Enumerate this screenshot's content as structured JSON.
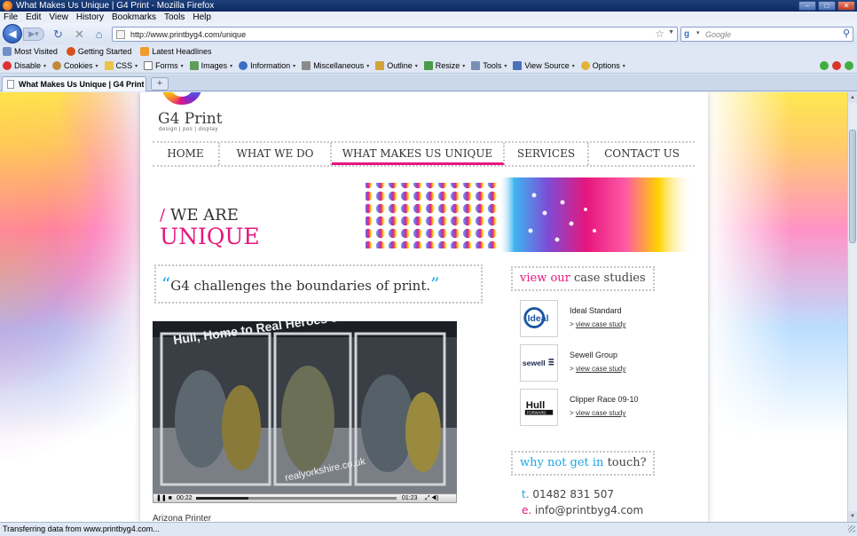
{
  "window": {
    "title": "What Makes Us Unique | G4 Print - Mozilla Firefox",
    "controls": [
      "–",
      "□",
      "✕"
    ]
  },
  "menu": [
    "File",
    "Edit",
    "View",
    "History",
    "Bookmarks",
    "Tools",
    "Help"
  ],
  "navigation": {
    "url": "http://www.printbyg4.com/unique",
    "search_placeholder": "Google"
  },
  "bookmarks": [
    "Most Visited",
    "Getting Started",
    "Latest Headlines"
  ],
  "devtoolbar": [
    "Disable",
    "Cookies",
    "CSS",
    "Forms",
    "Images",
    "Information",
    "Miscellaneous",
    "Outline",
    "Resize",
    "Tools",
    "View Source",
    "Options"
  ],
  "tab": {
    "label": "What Makes Us Unique | G4 Print",
    "new_tab": "+"
  },
  "site": {
    "logo": {
      "name": "G4 Print",
      "tagline": "design | pos | display"
    },
    "nav": [
      {
        "label": "HOME",
        "active": false
      },
      {
        "label": "WHAT WE DO",
        "active": false
      },
      {
        "label": "WHAT MAKES US UNIQUE",
        "active": true
      },
      {
        "label": "SERVICES",
        "active": false
      },
      {
        "label": "CONTACT US",
        "active": false
      }
    ],
    "banner": {
      "slash": "/",
      "line1": "WE ARE",
      "line2": "UNIQUE"
    },
    "quote": {
      "open": "“",
      "text": "G4 challenges the boundaries of print.",
      "close": "”"
    },
    "video": {
      "sign_text": "Hull, Home to Real Heroes & Champions",
      "url_text": "realyorkshire.co.uk",
      "time_current": "00:22",
      "time_total": "01:23",
      "progress": 0.26,
      "caption": "Arizona Printer"
    },
    "case_studies": {
      "heading_pre": "view our",
      "heading_post": "case studies",
      "link_prefix": ">",
      "items": [
        {
          "name": "Ideal Standard",
          "link": "view case study",
          "thumb_text": "Ideal"
        },
        {
          "name": "Sewell Group",
          "link": "view case study",
          "thumb_text": "sewell"
        },
        {
          "name": "Clipper Race 09-10",
          "link": "view case study",
          "thumb_text": "Hull",
          "thumb_sub": "FORWARD"
        }
      ]
    },
    "contact": {
      "heading_pre": "why not get in",
      "heading_post": "touch?",
      "phone_key": "t.",
      "phone": "01482 831 507",
      "email_key": "e.",
      "email": "info@printbyg4.com"
    }
  },
  "status": "Transferring data from www.printbyg4.com...",
  "colors": {
    "brand_pink": "#e6167d",
    "brand_blue": "#1aa7e8",
    "brand_yellow": "#ffd200"
  }
}
